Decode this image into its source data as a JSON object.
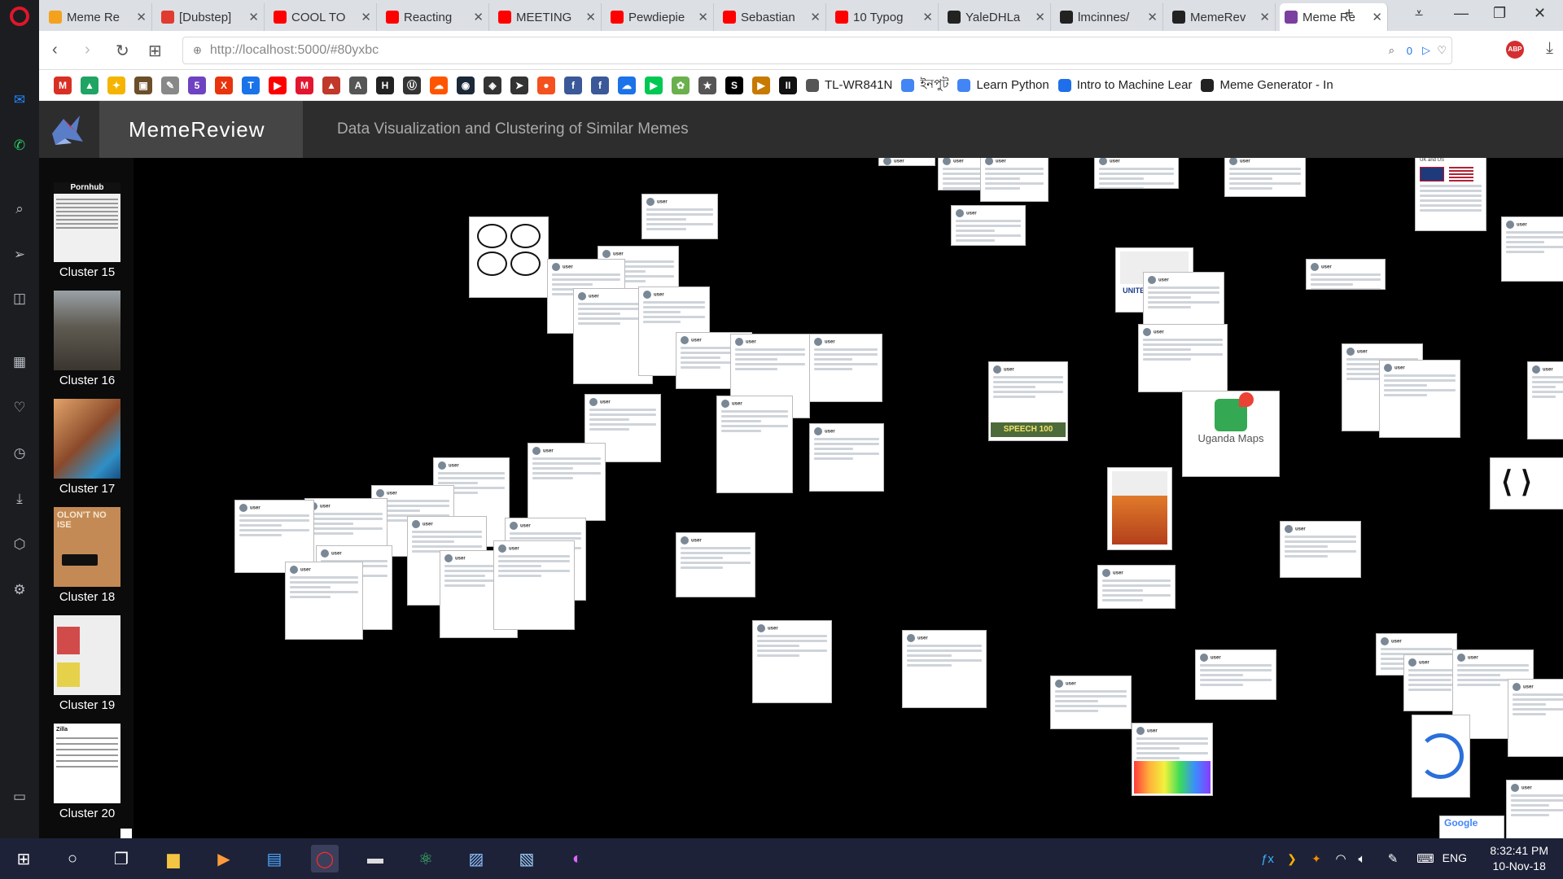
{
  "browser": {
    "tabs": [
      {
        "label": "Meme Re",
        "color": "#f4a21e"
      },
      {
        "label": "[Dubstep]",
        "color": "#e03b2e"
      },
      {
        "label": "COOL TO",
        "color": "#ff0000"
      },
      {
        "label": "Reacting",
        "color": "#ff0000"
      },
      {
        "label": "MEETING",
        "color": "#ff0000"
      },
      {
        "label": "Pewdiepie",
        "color": "#ff0000"
      },
      {
        "label": "Sebastian",
        "color": "#ff0000"
      },
      {
        "label": "10 Typog",
        "color": "#ff0000"
      },
      {
        "label": "YaleDHLa",
        "color": "#222222"
      },
      {
        "label": "lmcinnes/",
        "color": "#222222"
      },
      {
        "label": "MemeRev",
        "color": "#222222"
      },
      {
        "label": "Meme Re",
        "color": "#7b3fa0"
      }
    ],
    "url": "http://localhost:5000/#80yxbc",
    "adblock_count": "0",
    "bookmarks": [
      {
        "label": "",
        "color": "#d93025",
        "glyph": "M"
      },
      {
        "label": "",
        "color": "#1fa463",
        "glyph": "▲"
      },
      {
        "label": "",
        "color": "#f4b400",
        "glyph": "✦"
      },
      {
        "label": "",
        "color": "#6b4f2a",
        "glyph": "▣"
      },
      {
        "label": "",
        "color": "#888888",
        "glyph": "✎"
      },
      {
        "label": "",
        "color": "#6f42c1",
        "glyph": "5"
      },
      {
        "label": "",
        "color": "#e8340c",
        "glyph": "X"
      },
      {
        "label": "",
        "color": "#1a73e8",
        "glyph": "T"
      },
      {
        "label": "",
        "color": "#ff0000",
        "glyph": "▶"
      },
      {
        "label": "",
        "color": "#e2162f",
        "glyph": "M"
      },
      {
        "label": "",
        "color": "#c0392b",
        "glyph": "▲"
      },
      {
        "label": "",
        "color": "#555555",
        "glyph": "A"
      },
      {
        "label": "",
        "color": "#222222",
        "glyph": "H"
      },
      {
        "label": "",
        "color": "#333333",
        "glyph": "Ⓤ"
      },
      {
        "label": "",
        "color": "#ff5500",
        "glyph": "☁"
      },
      {
        "label": "",
        "color": "#1b2838",
        "glyph": "◉"
      },
      {
        "label": "",
        "color": "#333333",
        "glyph": "◈"
      },
      {
        "label": "",
        "color": "#333333",
        "glyph": "➤"
      },
      {
        "label": "",
        "color": "#f4511e",
        "glyph": "●"
      },
      {
        "label": "",
        "color": "#3b5998",
        "glyph": "f"
      },
      {
        "label": "",
        "color": "#3b5998",
        "glyph": "f"
      },
      {
        "label": "",
        "color": "#1a73e8",
        "glyph": "☁"
      },
      {
        "label": "",
        "color": "#00c853",
        "glyph": "▶"
      },
      {
        "label": "",
        "color": "#6ab04c",
        "glyph": "✿"
      },
      {
        "label": "",
        "color": "#555555",
        "glyph": "★"
      },
      {
        "label": "",
        "color": "#000000",
        "glyph": "S"
      },
      {
        "label": "",
        "color": "#c77a00",
        "glyph": "▶"
      },
      {
        "label": "",
        "color": "#111111",
        "glyph": "II"
      }
    ],
    "bookmark_texts": [
      "TL-WR841N",
      "ইনপুট",
      "Learn Python",
      "Intro to Machine Lear",
      "Meme Generator - In"
    ]
  },
  "app": {
    "brand": "MemeReview",
    "subtitle": "Data Visualization and Clustering of Similar Memes"
  },
  "sidebar": {
    "clusters": [
      {
        "label": "Cluster 15",
        "thumb": "#f0f0f0",
        "thumb_text": "Pornhub"
      },
      {
        "label": "Cluster 16",
        "thumb": "#6f6a60",
        "thumb_text": ""
      },
      {
        "label": "Cluster 17",
        "thumb": "#b06b3a",
        "thumb_text": ""
      },
      {
        "label": "Cluster 18",
        "thumb": "#b98250",
        "thumb_text": "OLON'T NO ISE"
      },
      {
        "label": "Cluster 19",
        "thumb": "#e9e9e9",
        "thumb_text": ""
      },
      {
        "label": "Cluster 20",
        "thumb": "#ffffff",
        "thumb_text": "Zilla"
      }
    ]
  },
  "canvas_texts": {
    "uganda": "Uganda Maps",
    "united": "UNITED AIRLINES",
    "speech": "SPEECH 100",
    "brit": "UK and US",
    "google": "Google"
  },
  "taskbar": {
    "lang": "ENG",
    "time": "8:32:41 PM",
    "date": "10-Nov-18"
  }
}
